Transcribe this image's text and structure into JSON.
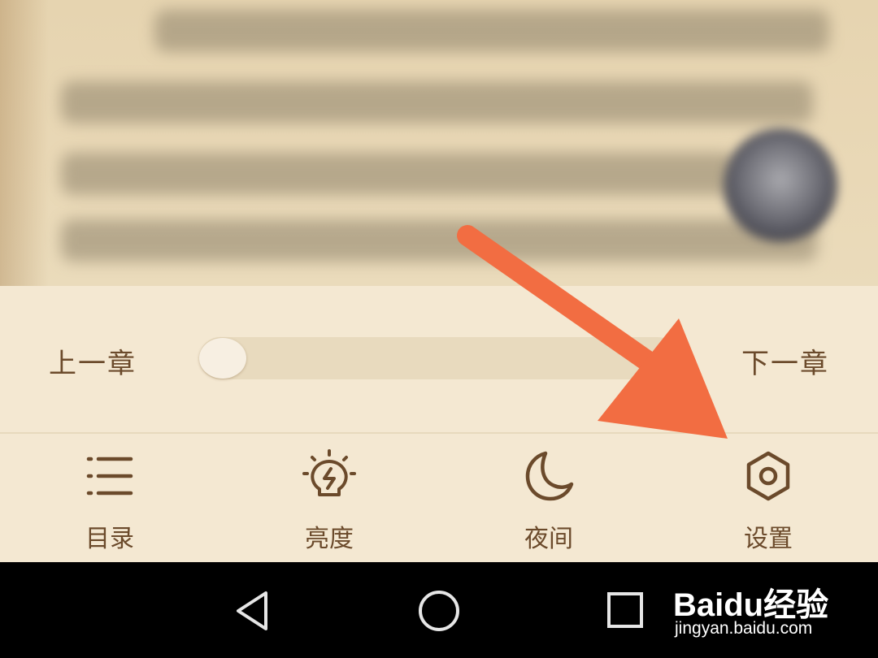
{
  "reader": {
    "prev_chapter": "上一章",
    "next_chapter": "下一章",
    "progress": 0.0
  },
  "toolbar": [
    {
      "label": "目录",
      "icon": "list-icon"
    },
    {
      "label": "亮度",
      "icon": "bulb-icon"
    },
    {
      "label": "夜间",
      "icon": "moon-icon"
    },
    {
      "label": "设置",
      "icon": "settings-hexagon-icon"
    }
  ],
  "navbar": {
    "back": "back-triangle-icon",
    "home": "home-circle-icon",
    "recents": "recents-square-icon"
  },
  "watermark": {
    "brand": "Baidu经验",
    "url": "jingyan.baidu.com"
  },
  "colors": {
    "accent_text": "#6b4a2b",
    "panel_bg": "#f4e8d2",
    "annotation_arrow": "#f26d42"
  }
}
